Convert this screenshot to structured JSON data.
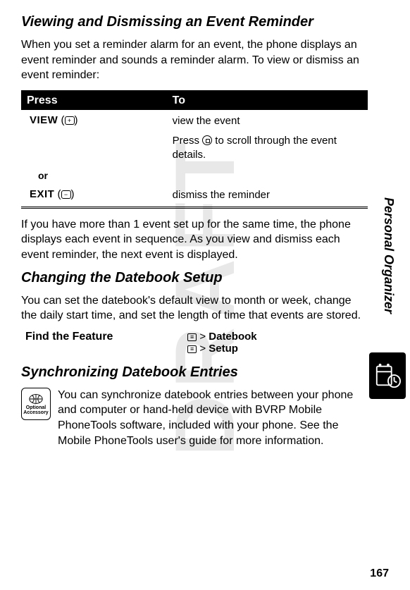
{
  "watermark": "DRAFT",
  "side_label": "Personal Organizer",
  "page_number": "167",
  "section1": {
    "heading": "Viewing and Dismissing an Event Reminder",
    "intro": "When you set a reminder alarm for an event, the phone displays an event reminder and sounds a reminder alarm. To view or dismiss an event reminder:",
    "table": {
      "col1": "Press",
      "col2": "To",
      "rows": [
        {
          "action": "VIEW",
          "key_glyph": "+",
          "desc1": "view the event",
          "desc2a": "Press ",
          "desc2b": " to scroll through the event details."
        },
        {
          "or": "or"
        },
        {
          "action": "EXIT",
          "key_glyph": "−",
          "desc1": "dismiss the reminder"
        }
      ]
    },
    "after": "If you have more than 1 event set up for the same time, the phone displays each event in sequence. As you view and dismiss each event reminder, the next event is displayed."
  },
  "section2": {
    "heading": "Changing the Datebook Setup",
    "intro": "You can set the datebook's default view to month or week, change the daily start time, and set the length of time that events are stored.",
    "find_label": "Find the Feature",
    "path1": "Datebook",
    "path2": "Setup"
  },
  "section3": {
    "heading": "Synchronizing Datebook Entries",
    "accessory_label_top": "Optional",
    "accessory_label_bottom": "Accessory",
    "body": "You can synchronize datebook entries between your phone and computer or hand-held device with BVRP Mobile PhoneTools software, included with your phone. See the Mobile PhoneTools user's guide for more information."
  }
}
